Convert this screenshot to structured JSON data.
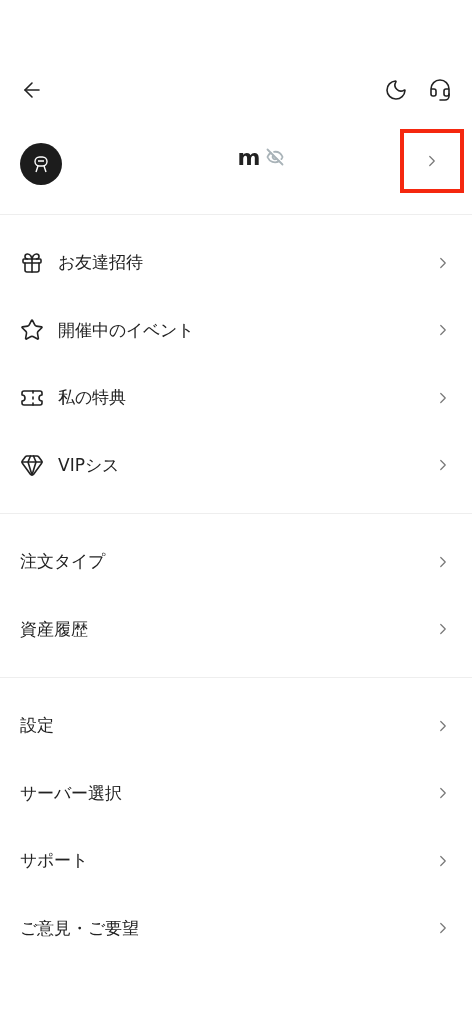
{
  "profile": {
    "name": "m",
    "name_hidden": true,
    "chevron_highlighted": true
  },
  "sections": [
    {
      "items": [
        {
          "label": "お友達招待"
        },
        {
          "label": "開催中のイベント"
        },
        {
          "label": "私の特典"
        },
        {
          "label": "VIPシス"
        }
      ]
    },
    {
      "items": [
        {
          "label": "注文タイプ"
        },
        {
          "label": "資産履歴"
        }
      ]
    },
    {
      "items": [
        {
          "label": "設定"
        },
        {
          "label": "サーバー選択"
        },
        {
          "label": "サポート"
        },
        {
          "label": "ご意見・ご要望"
        }
      ]
    }
  ]
}
